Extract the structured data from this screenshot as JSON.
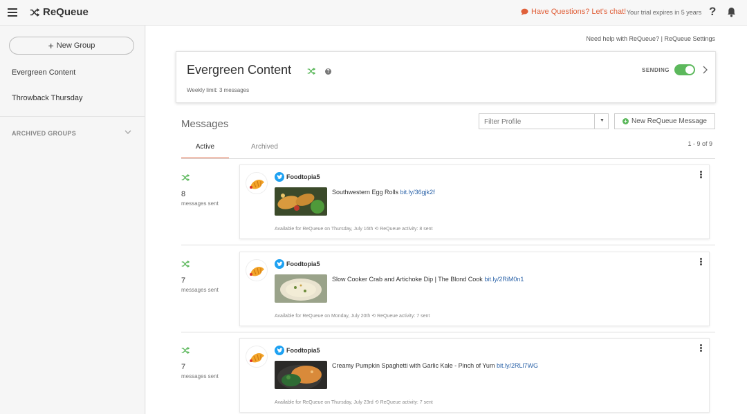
{
  "header": {
    "app_name": "ReQueue",
    "chat_label": "Have Questions? Let's chat!",
    "trial_text": "Your trial expires in 5 years",
    "help_glyph": "?"
  },
  "sidebar": {
    "new_group_label": "New Group",
    "groups": [
      {
        "label": "Evergreen Content"
      },
      {
        "label": "Throwback Thursday"
      }
    ],
    "archived_label": "ARCHIVED GROUPS"
  },
  "main": {
    "help_link": "Need help with ReQueue?",
    "links_separator": "|",
    "settings_link": "ReQueue Settings",
    "group": {
      "title": "Evergreen Content",
      "help_glyph": "?",
      "weekly_limit": "Weekly limit: 3 messages",
      "status_label": "SENDING",
      "sending_on": true
    },
    "messages_title": "Messages",
    "filter_placeholder": "Filter Profile",
    "new_message_label": "New ReQueue Message",
    "tabs": [
      {
        "label": "Active",
        "active": true
      },
      {
        "label": "Archived",
        "active": false
      }
    ],
    "count_text": "1 - 9 of 9",
    "items": [
      {
        "sent_count": "8",
        "sent_label": "messages sent",
        "handle": "Foodtopia5",
        "text": "Southwestern Egg Rolls",
        "link": "bit.ly/36gjk2f",
        "availability": "Available for ReQueue on Thursday, July 16th",
        "activity": "ReQueue activity: 8 sent"
      },
      {
        "sent_count": "7",
        "sent_label": "messages sent",
        "handle": "Foodtopia5",
        "text": "Slow Cooker Crab and Artichoke Dip | The Blond Cook",
        "link": "bit.ly/2RiM0n1",
        "availability": "Available for ReQueue on Monday, July 20th",
        "activity": "ReQueue activity: 7 sent"
      },
      {
        "sent_count": "7",
        "sent_label": "messages sent",
        "handle": "Foodtopia5",
        "text": "Creamy Pumpkin Spaghetti with Garlic Kale - Pinch of Yum",
        "link": "bit.ly/2RLl7WG",
        "availability": "Available for ReQueue on Thursday, July 23rd",
        "activity": "ReQueue activity: 7 sent"
      }
    ]
  },
  "colors": {
    "accent_orange": "#e0603a",
    "toggle_green": "#5cb85c",
    "shuffle_green": "#5cb85c",
    "twitter_blue": "#1da1f2",
    "link_blue": "#2a62a8"
  },
  "icons": {
    "menu": "hamburger-icon",
    "logo": "shuffle-icon",
    "chat": "speech-bubble-icon",
    "help": "question-icon",
    "notifications": "bell-icon",
    "expand": "chevron-down-icon",
    "open_group": "chevron-right-icon",
    "profile": "twitter-icon",
    "activity": "history-icon",
    "more": "kebab-icon"
  }
}
